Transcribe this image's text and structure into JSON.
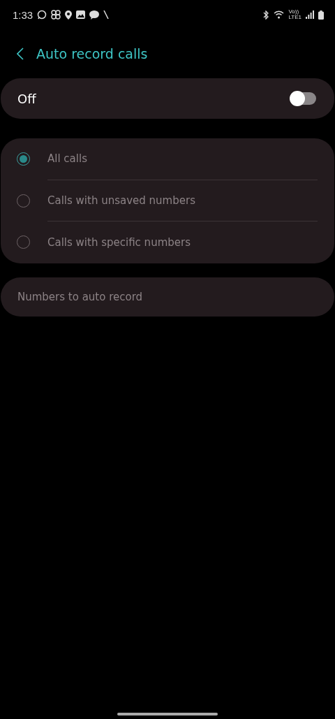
{
  "status_bar": {
    "time": "1:33",
    "network_top": "Vo))",
    "network_bottom": "LTE1"
  },
  "header": {
    "title": "Auto record calls"
  },
  "master_switch": {
    "label": "Off",
    "on": false
  },
  "options": [
    {
      "label": "All calls",
      "selected": true,
      "disabled": true
    },
    {
      "label": "Calls with unsaved numbers",
      "selected": false,
      "disabled": true
    },
    {
      "label": "Calls with specific numbers",
      "selected": false,
      "disabled": true
    }
  ],
  "numbers_item": {
    "label": "Numbers to auto record",
    "disabled": true
  }
}
